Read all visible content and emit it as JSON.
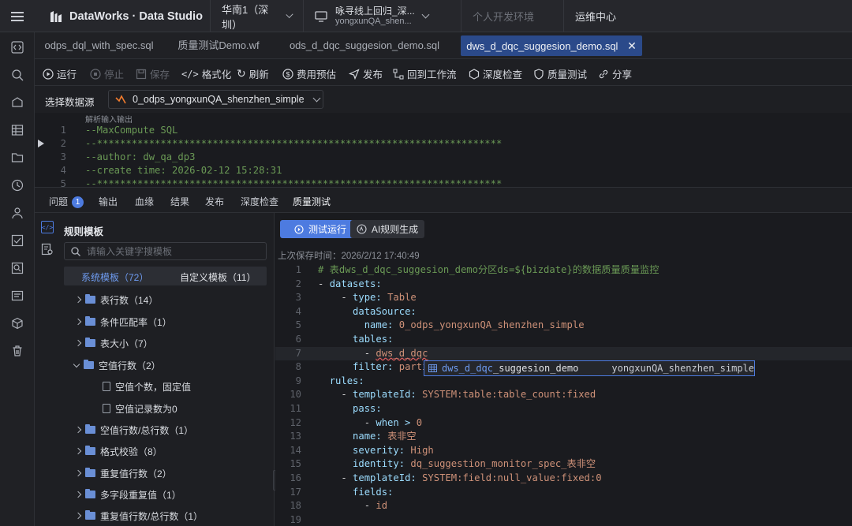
{
  "app": {
    "logo": "DataWorks · Data Studio",
    "region": "华南1（深圳）",
    "project_name": "咏寻线上回归_深...",
    "project_sub": "yongxunQA_shen...",
    "env": "个人开发环境",
    "ops": "运维中心"
  },
  "tabs": [
    {
      "label": "odps_dql_with_spec.sql"
    },
    {
      "label": "质量测试Demo.wf"
    },
    {
      "label": "ods_d_dqc_suggesion_demo.sql"
    },
    {
      "label": "dws_d_dqc_suggesion_demo.sql"
    }
  ],
  "toolbar": {
    "run": "运行",
    "stop": "停止",
    "save": "保存",
    "format": "格式化",
    "refresh": "刷新",
    "cost": "费用预估",
    "publish": "发布",
    "back": "回到工作流",
    "deep": "深度检查",
    "quality": "质量测试",
    "share": "分享"
  },
  "datasource": {
    "label": "选择数据源",
    "value": "0_odps_yongxunQA_shenzhen_simple"
  },
  "editor_top": {
    "hint": "解析输入输出",
    "lines": [
      {
        "n": "1",
        "t": "--MaxCompute SQL"
      },
      {
        "n": "2",
        "t": "--**********************************************************************"
      },
      {
        "n": "3",
        "t": "--author: dw_qa_dp3"
      },
      {
        "n": "4",
        "t": "--create time: 2026-02-12 15:28:31"
      },
      {
        "n": "5",
        "t": "--**********************************************************************"
      }
    ]
  },
  "bottom_tabs": {
    "issues": "问题",
    "issues_count": "1",
    "output": "输出",
    "lineage": "血缘",
    "result": "结果",
    "publish": "发布",
    "deep": "深度检查",
    "quality": "质量测试"
  },
  "rules": {
    "title": "规则模板",
    "search_placeholder": "请输入关键字搜模板",
    "system_tab": "系统模板（72）",
    "custom_tab": "自定义模板（11）",
    "items": [
      {
        "label": "表行数（14）"
      },
      {
        "label": "条件匹配率（1）"
      },
      {
        "label": "表大小（7）"
      },
      {
        "label": "空值行数（2）"
      },
      {
        "label": "空值个数，固定值"
      },
      {
        "label": "空值记录数为0"
      },
      {
        "label": "空值行数/总行数（1）"
      },
      {
        "label": "格式校验（8）"
      },
      {
        "label": "重复值行数（2）"
      },
      {
        "label": "多字段重复值（1）"
      },
      {
        "label": "重复值行数/总行数（1）"
      }
    ]
  },
  "actions": {
    "test_run": "测试运行",
    "ai_gen": "AI规则生成",
    "saved": "上次保存时间：2026/2/12 17:40:49"
  },
  "yaml": [
    {
      "n": "1",
      "a": "",
      "k": "# 表dws_d_dqc_suggesion_demo分区ds=${bizdate}的数据质量质量监控",
      "v": ""
    },
    {
      "n": "2",
      "a": "- ",
      "k": "datasets:",
      "v": ""
    },
    {
      "n": "3",
      "a": "    - ",
      "k": "type: ",
      "v": "Table"
    },
    {
      "n": "4",
      "a": "      ",
      "k": "dataSource:",
      "v": ""
    },
    {
      "n": "5",
      "a": "        ",
      "k": "name: ",
      "v": "0_odps_yongxunQA_shenzhen_simple"
    },
    {
      "n": "6",
      "a": "      ",
      "k": "tables:",
      "v": ""
    },
    {
      "n": "7",
      "a": "        - ",
      "k": "",
      "v": "dws_d_dqc"
    },
    {
      "n": "8",
      "a": "      ",
      "k": "filter: ",
      "v": "parti"
    },
    {
      "n": "9",
      "a": "  ",
      "k": "rules:",
      "v": ""
    },
    {
      "n": "10",
      "a": "    - ",
      "k": "templateId: ",
      "v": "SYSTEM:table:table_count:fixed"
    },
    {
      "n": "11",
      "a": "      ",
      "k": "pass:",
      "v": ""
    },
    {
      "n": "12",
      "a": "        - ",
      "k": "when > ",
      "v": "0"
    },
    {
      "n": "13",
      "a": "      ",
      "k": "name: ",
      "v": "表非空"
    },
    {
      "n": "14",
      "a": "      ",
      "k": "severity: ",
      "v": "High"
    },
    {
      "n": "15",
      "a": "      ",
      "k": "identity: ",
      "v": "dq_suggestion_monitor_spec_表非空"
    },
    {
      "n": "16",
      "a": "    - ",
      "k": "templateId: ",
      "v": "SYSTEM:field:null_value:fixed:0"
    },
    {
      "n": "17",
      "a": "      ",
      "k": "fields:",
      "v": ""
    },
    {
      "n": "18",
      "a": "        - ",
      "k": "",
      "v": "id"
    },
    {
      "n": "19",
      "a": "",
      "k": "",
      "v": ""
    }
  ],
  "suggestion": {
    "match": "dws_d_dqc",
    "rest": "_suggesion_demo",
    "project": "yongxunQA_shenzhen_simple"
  }
}
